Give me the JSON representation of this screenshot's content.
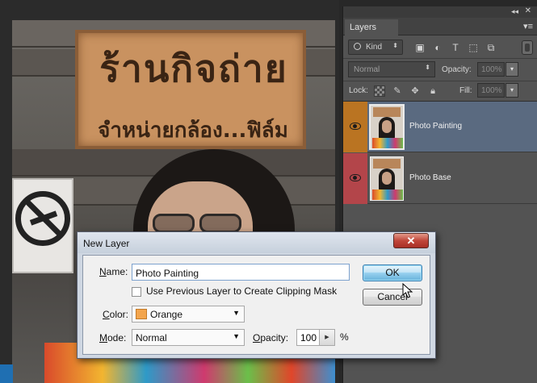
{
  "canvas": {
    "sign": {
      "line1": "ร้านกิจถ่าย",
      "line2": "จำหน่ายกล้อง...ฟิล์ม"
    }
  },
  "layers_panel": {
    "tab_label": "Layers",
    "collapse_glyph": "◂◂",
    "close_glyph": "✕",
    "menu_glyph": "▾≡",
    "filter": {
      "kind_label": "Kind",
      "icons": [
        "image-filter-icon",
        "adjustment-filter-icon",
        "type-filter-icon",
        "shape-filter-icon",
        "smart-object-filter-icon"
      ]
    },
    "blend_mode": "Normal",
    "opacity_label": "Opacity:",
    "opacity_value": "100%",
    "lock_label": "Lock:",
    "fill_label": "Fill:",
    "fill_value": "100%",
    "layers": [
      {
        "name": "Photo Painting",
        "active": true,
        "tag_color": "#ba7422"
      },
      {
        "name": "Photo Base",
        "active": false,
        "tag_color": "#b3454a"
      }
    ]
  },
  "dialog": {
    "title": "New Layer",
    "close_glyph": "✕",
    "name_label_key": "N",
    "name_label_rest": "ame:",
    "name_value": "Photo Painting",
    "clipping_label": "Use Previous Layer to Create Clipping Mask",
    "clipping_checked": false,
    "color_label_key": "C",
    "color_label_rest": "olor:",
    "color_value": "Orange",
    "color_swatch": "#f3a54d",
    "mode_label_key": "M",
    "mode_label_rest": "ode:",
    "mode_value": "Normal",
    "opacity_label_key": "O",
    "opacity_label_rest": "pacity:",
    "opacity_value": "100",
    "opacity_unit": "%",
    "ok_label": "OK",
    "cancel_label": "Cancel"
  }
}
